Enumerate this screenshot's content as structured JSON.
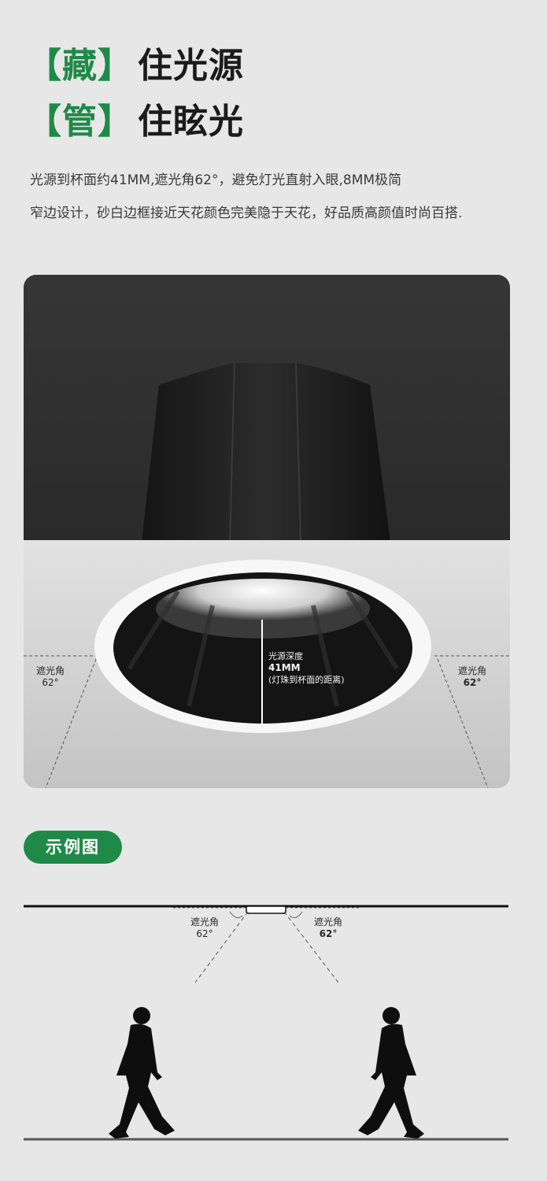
{
  "headline": {
    "line1": {
      "bracket": "【藏】",
      "text": "住光源"
    },
    "line2": {
      "bracket": "【管】",
      "text": "住眩光"
    }
  },
  "description": {
    "line1": "光源到杯面约41MM,遮光角62°，避免灯光直射入眼,8MM极简",
    "line2": "窄边设计，砂白边框接近天花颜色完美隐于天花，好品质高颜值时尚百搭."
  },
  "product_image": {
    "left_angle": {
      "label": "遮光角",
      "value": "62°"
    },
    "right_angle": {
      "label": "遮光角",
      "value": "62°"
    },
    "depth": {
      "label": "光源深度",
      "value": "41MM",
      "note": "(灯珠到杯面的距离)"
    }
  },
  "example": {
    "badge": "示例图",
    "left_angle": {
      "label": "遮光角",
      "value": "62°"
    },
    "right_angle": {
      "label": "遮光角",
      "value": "62°"
    }
  },
  "colors": {
    "accent_green": "#1f8a48",
    "background": "#e7e7e7",
    "housing_black": "#1a1a1a",
    "trim_white": "#f5f5f5"
  }
}
